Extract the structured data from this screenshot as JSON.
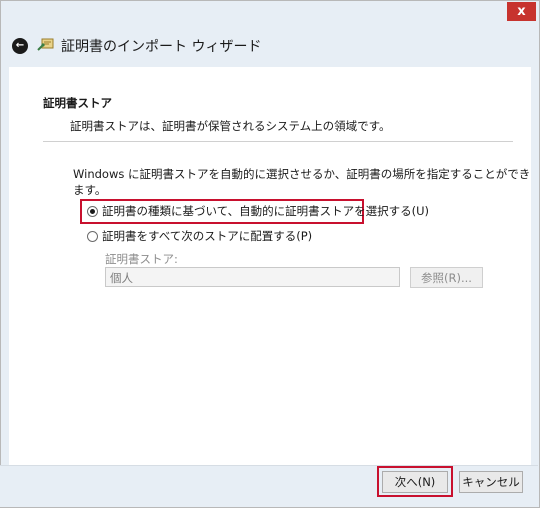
{
  "window": {
    "close_glyph": "x"
  },
  "wizard": {
    "title": "証明書のインポート ウィザード",
    "back_icon": "back-arrow-icon",
    "wizard_icon": "certificate-wizard-icon"
  },
  "section": {
    "title": "証明書ストア",
    "description": "証明書ストアは、証明書が保管されるシステム上の領域です。",
    "instruction": "Windows に証明書ストアを自動的に選択させるか、証明書の場所を指定することができます。"
  },
  "options": {
    "auto_label": "証明書の種類に基づいて、自動的に証明書ストアを選択する(U)",
    "auto_checked": true,
    "manual_label": "証明書をすべて次のストアに配置する(P)",
    "manual_checked": false
  },
  "store": {
    "label": "証明書ストア:",
    "value": "個人",
    "browse_label": "参照(R)..."
  },
  "footer": {
    "next_label": "次へ(N)",
    "cancel_label": "キャンセル"
  },
  "colors": {
    "highlight": "#c8102e",
    "close": "#c7332e",
    "chrome": "#e7eef5"
  }
}
